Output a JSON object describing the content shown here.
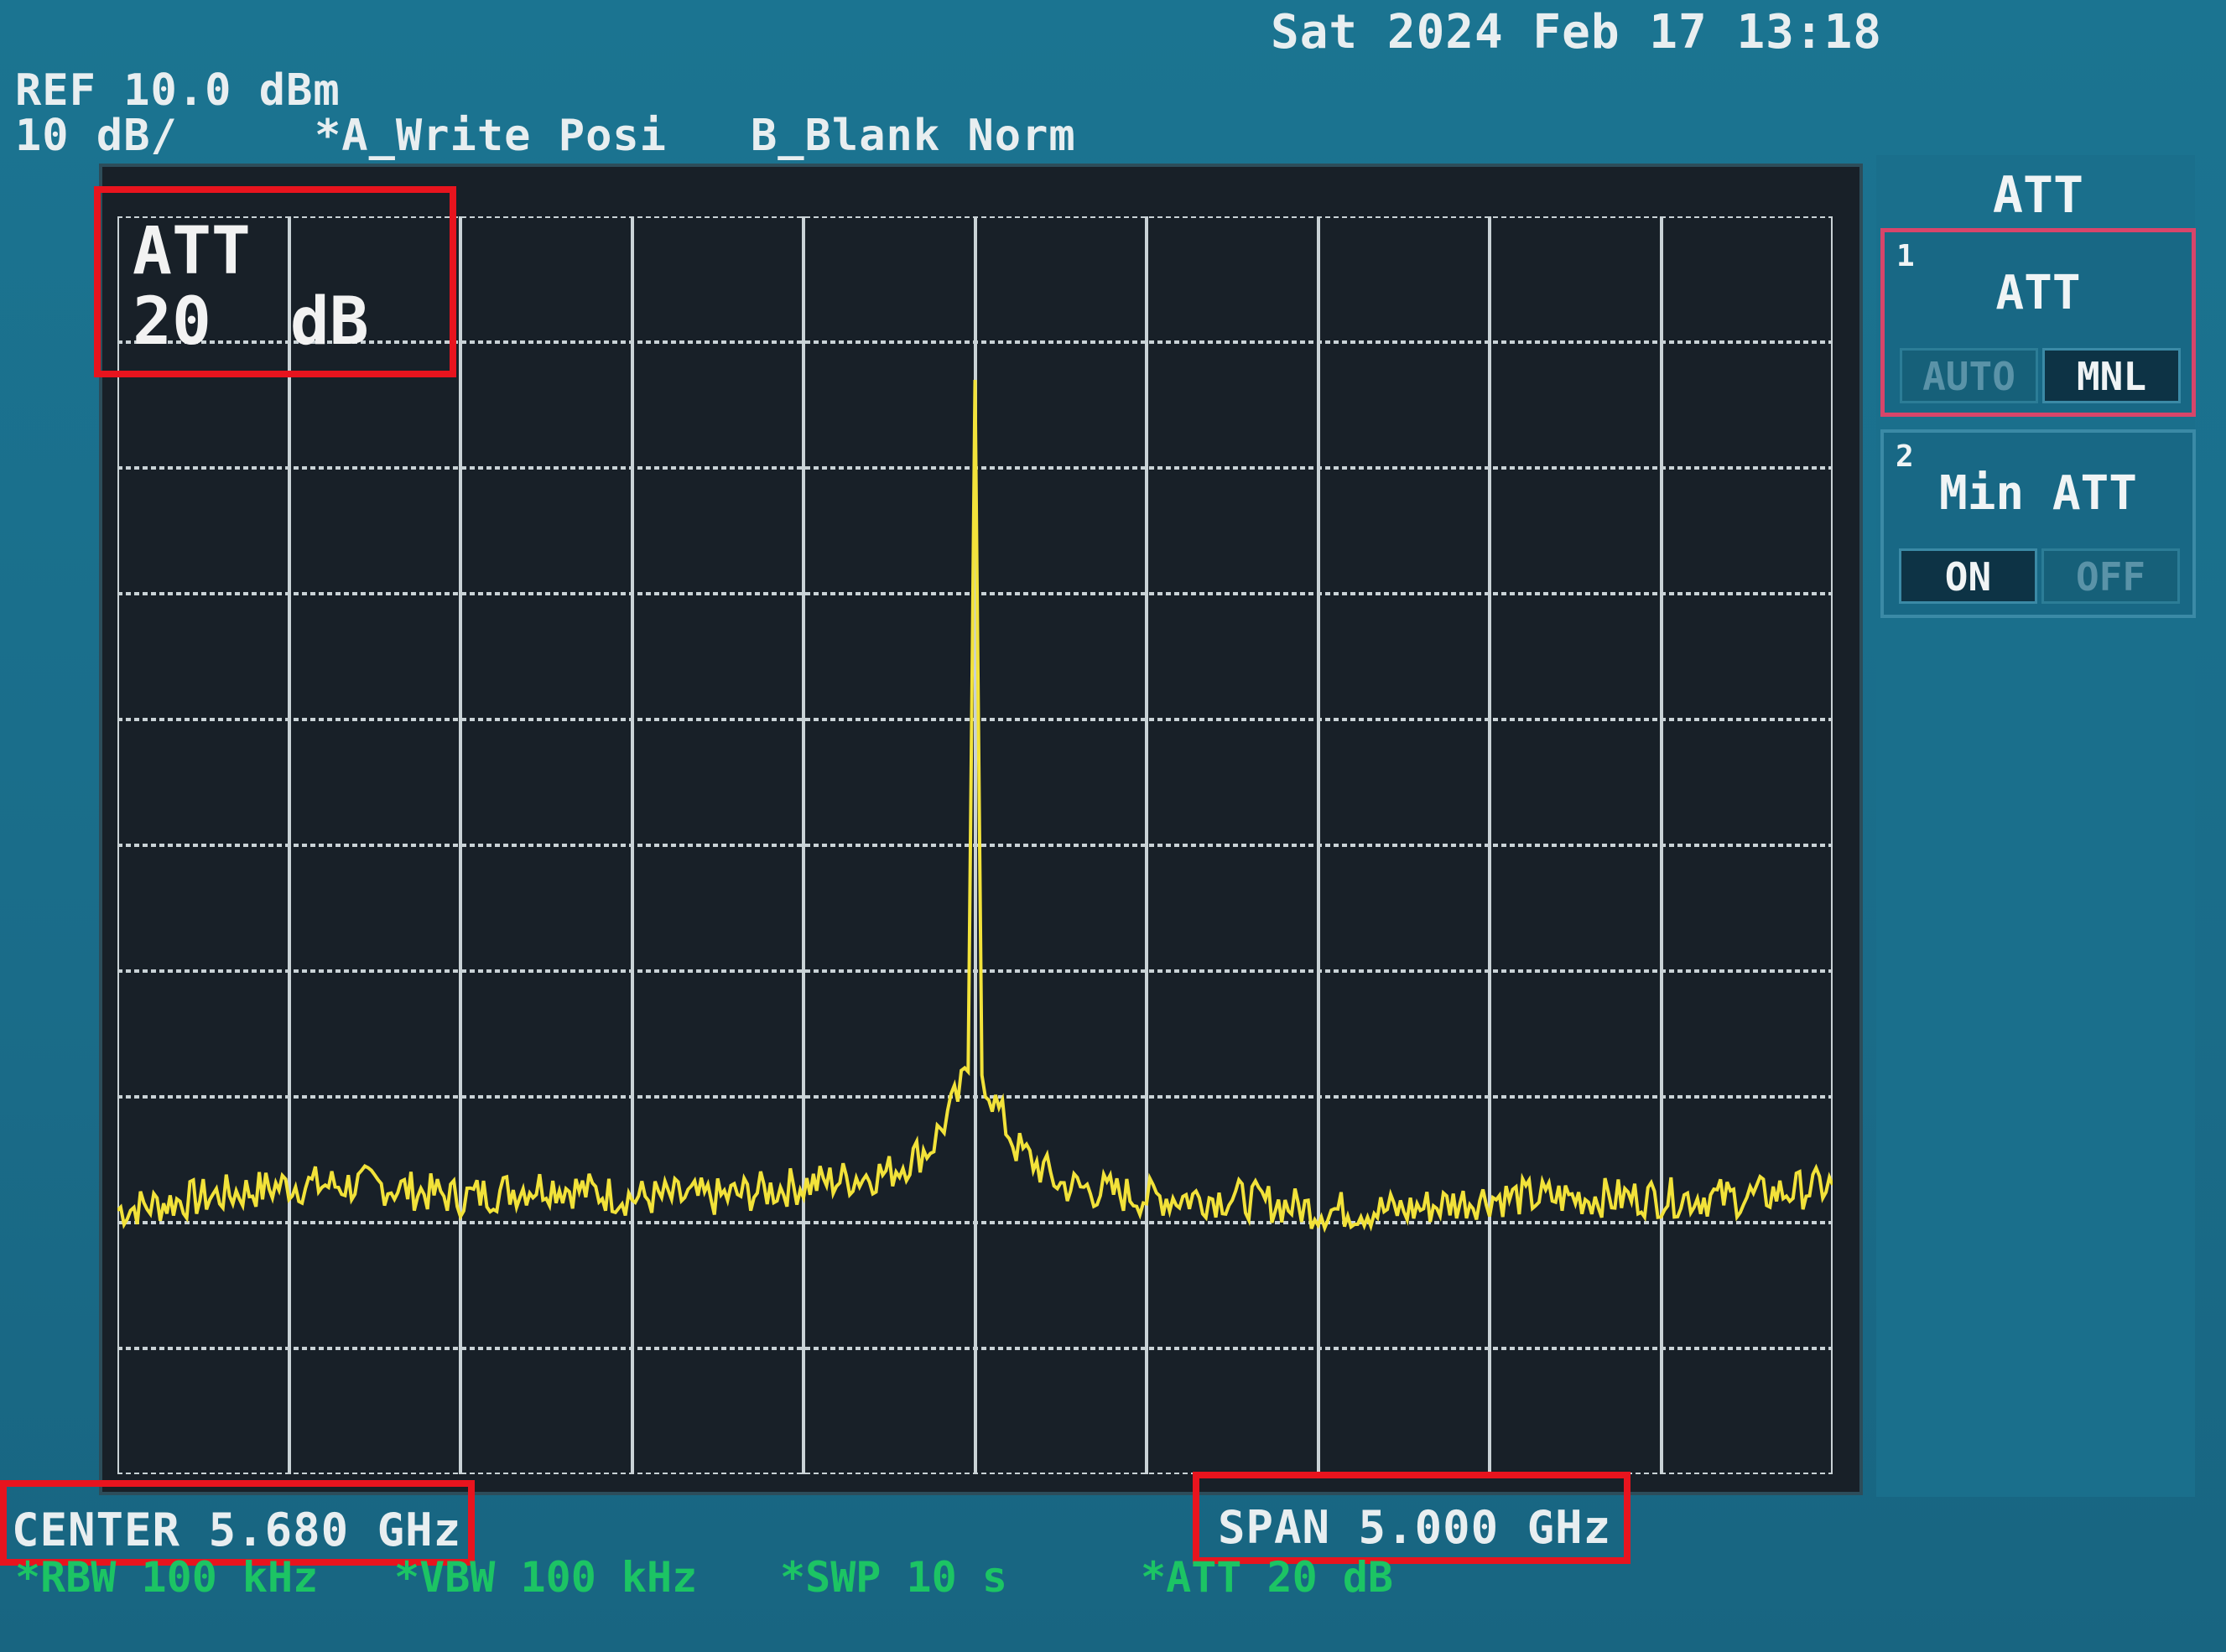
{
  "header": {
    "datetime": "Sat 2024 Feb 17 13:18",
    "ref_level": "REF 10.0 dBm",
    "scale": "10 dB/",
    "trace_a": "*A_Write Posi",
    "trace_b": "B_Blank Norm"
  },
  "display": {
    "att_overlay_line1": "ATT",
    "att_overlay_line2": "20  dB",
    "trace_color": "#f2e23a",
    "grid_color": "#c9d2d6",
    "background_color": "#182028"
  },
  "footer": {
    "center": "CENTER 5.680 GHz",
    "span": "SPAN 5.000 GHz",
    "rbw": "*RBW 100 kHz",
    "vbw": "*VBW 100 kHz",
    "swp": "*SWP 10 s",
    "att": "*ATT 20 dB"
  },
  "softkeys": {
    "title": "ATT",
    "items": [
      {
        "num": "1",
        "label": "ATT",
        "options": [
          "AUTO",
          "MNL"
        ],
        "selected": "MNL"
      },
      {
        "num": "2",
        "label": "Min ATT",
        "options": [
          "ON",
          "OFF"
        ],
        "selected": "ON"
      }
    ]
  },
  "chart_data": {
    "type": "line",
    "x_unit": "GHz",
    "y_unit": "dBm",
    "xlim": [
      3.18,
      8.18
    ],
    "ylim": [
      -90,
      10
    ],
    "grid": true,
    "series": [
      {
        "x": [
          3.18,
          3.43,
          3.68,
          3.93,
          4.18,
          4.43,
          4.68,
          4.93,
          5.18,
          5.43,
          5.55,
          5.63,
          5.66,
          5.68,
          5.7,
          5.73,
          5.8,
          5.93,
          6.18,
          6.43,
          6.68,
          6.93,
          7.18,
          7.43,
          7.68,
          7.93,
          8.18
        ],
        "y": [
          -69,
          -68,
          -67,
          -67,
          -68,
          -67,
          -68,
          -68,
          -67,
          -66,
          -64,
          -60,
          -58,
          -3,
          -58,
          -60,
          -64,
          -67,
          -68,
          -68,
          -69,
          -69,
          -68,
          -68,
          -68,
          -68,
          -67
        ]
      }
    ]
  }
}
